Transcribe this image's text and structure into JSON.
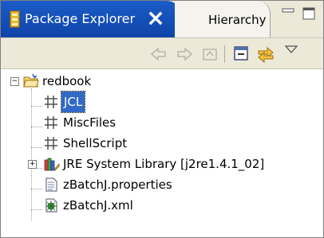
{
  "view": {
    "active_tab": {
      "label": "Package Explorer",
      "icon": "package-explorer-icon",
      "close_icon": "close-icon"
    },
    "inactive_tab": {
      "label": "Hierarchy"
    },
    "window_controls": [
      "minimize-icon",
      "maximize-icon"
    ]
  },
  "toolbar": {
    "buttons": [
      "back-icon",
      "forward-icon",
      "up-icon",
      "collapse-all-icon",
      "link-with-editor-icon",
      "view-menu-icon"
    ]
  },
  "tree": {
    "project": {
      "label": "redbook",
      "expanded": true
    },
    "children": [
      {
        "label": "JCL",
        "type": "package",
        "selected": true
      },
      {
        "label": "MiscFiles",
        "type": "package"
      },
      {
        "label": "ShellScript",
        "type": "package"
      },
      {
        "label": "JRE System Library [j2re1.4.1_02]",
        "type": "library",
        "expandable": true
      },
      {
        "label": "zBatchJ.properties",
        "type": "file"
      },
      {
        "label": "zBatchJ.xml",
        "type": "xml-file"
      }
    ]
  },
  "colors": {
    "active_tab": "#1b5cc8",
    "selection": "#316ac5",
    "chrome": "#ece9d8"
  }
}
